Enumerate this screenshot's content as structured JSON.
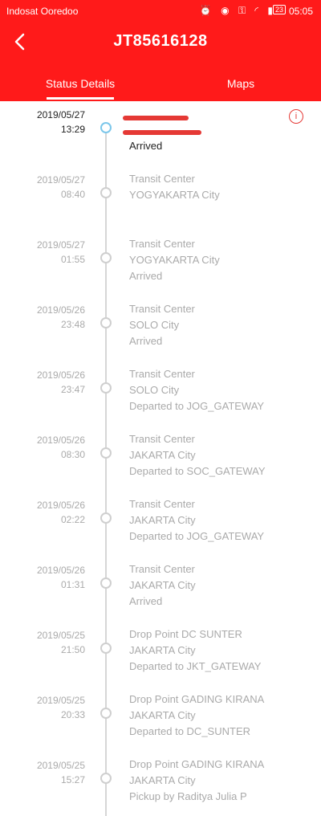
{
  "status_bar": {
    "carrier": "Indosat Ooredoo",
    "battery": "23",
    "time": "05:05"
  },
  "header": {
    "title": "JT85616128"
  },
  "tabs": [
    {
      "label": "Status Details"
    },
    {
      "label": "Maps"
    }
  ],
  "info_icon": "i",
  "entries": [
    {
      "date": "2019/05/27",
      "time": "13:29",
      "lines": [
        "Arrived"
      ],
      "active": true
    },
    {
      "date": "2019/05/27",
      "time": "08:40",
      "lines": [
        "Transit Center",
        "YOGYAKARTA City"
      ]
    },
    {
      "date": "2019/05/27",
      "time": "01:55",
      "lines": [
        "Transit Center",
        "YOGYAKARTA City",
        "Arrived"
      ]
    },
    {
      "date": "2019/05/26",
      "time": "23:48",
      "lines": [
        "Transit Center",
        "SOLO City",
        "Arrived"
      ]
    },
    {
      "date": "2019/05/26",
      "time": "23:47",
      "lines": [
        "Transit Center",
        "SOLO City",
        "Departed to JOG_GATEWAY"
      ]
    },
    {
      "date": "2019/05/26",
      "time": "08:30",
      "lines": [
        "Transit Center",
        "JAKARTA City",
        "Departed to SOC_GATEWAY"
      ]
    },
    {
      "date": "2019/05/26",
      "time": "02:22",
      "lines": [
        "Transit Center",
        "JAKARTA City",
        "Departed to JOG_GATEWAY"
      ]
    },
    {
      "date": "2019/05/26",
      "time": "01:31",
      "lines": [
        "Transit Center",
        "JAKARTA City",
        "Arrived"
      ]
    },
    {
      "date": "2019/05/25",
      "time": "21:50",
      "lines": [
        "Drop Point DC SUNTER",
        "JAKARTA City",
        "Departed to JKT_GATEWAY"
      ]
    },
    {
      "date": "2019/05/25",
      "time": "20:33",
      "lines": [
        "Drop Point GADING KIRANA",
        "JAKARTA City",
        "Departed to DC_SUNTER"
      ]
    },
    {
      "date": "2019/05/25",
      "time": "15:27",
      "lines": [
        "Drop Point GADING KIRANA",
        "JAKARTA City",
        "Pickup by Raditya Julia P"
      ]
    }
  ]
}
